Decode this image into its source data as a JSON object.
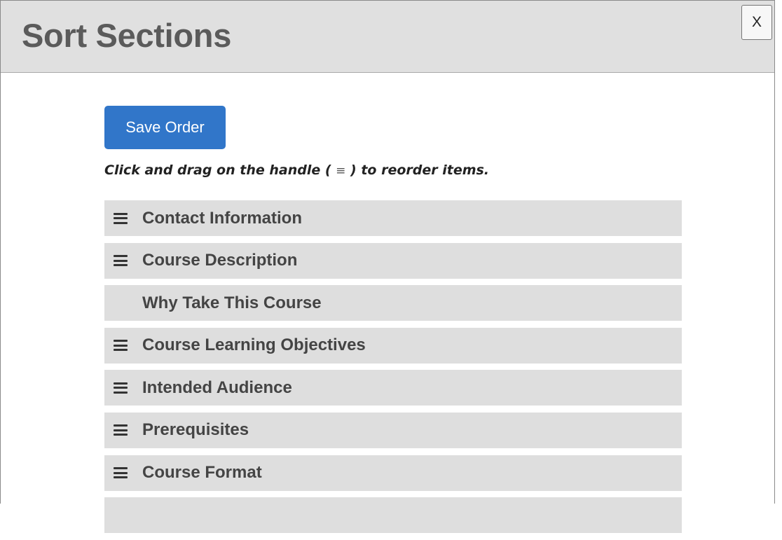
{
  "dialog": {
    "title": "Sort Sections",
    "close_label": "X"
  },
  "toolbar": {
    "save_label": "Save Order"
  },
  "instructions": {
    "before": "Click and drag on the handle ( ",
    "handle_glyph": "≡",
    "after": " ) to reorder items."
  },
  "sections": [
    {
      "label": "Contact Information",
      "draggable": true
    },
    {
      "label": "Course Description",
      "draggable": true
    },
    {
      "label": "Why Take This Course",
      "draggable": false
    },
    {
      "label": "Course Learning Objectives",
      "draggable": true
    },
    {
      "label": "Intended Audience",
      "draggable": true
    },
    {
      "label": "Prerequisites",
      "draggable": true
    },
    {
      "label": "Course Format",
      "draggable": true
    },
    {
      "label": "",
      "draggable": false
    }
  ],
  "icons": {
    "close": "close-icon",
    "drag_handle": "drag-handle-icon"
  },
  "colors": {
    "header_bg": "#e0e0e0",
    "title_text": "#5b5b5b",
    "primary_button": "#3176c9",
    "item_bg": "#dedede",
    "item_text": "#444444"
  }
}
